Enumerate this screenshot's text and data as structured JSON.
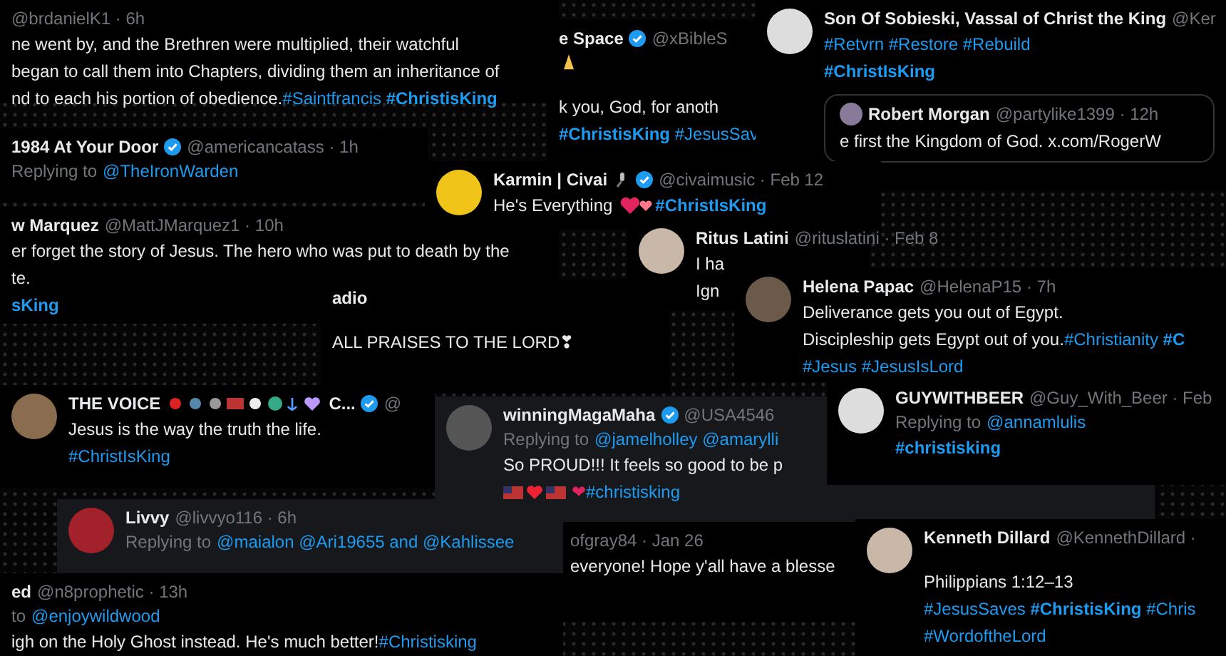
{
  "posts": [
    {
      "handle": "@brdanielK1 · 6h",
      "lines": [
        [
          {
            "t": "ne went by, and the Brethren were multiplied, their watchful",
            "link": false
          }
        ],
        [
          {
            "t": "began to call them into Chapters, dividing them an inheritance of",
            "link": false
          }
        ],
        [
          {
            "t": "nd to each his portion of obedience.",
            "link": false
          },
          {
            "t": "#Saintfrancis **#ChristisKing**",
            "link": true
          }
        ]
      ]
    },
    {
      "name": "e Space",
      "handle": "@xBibleS",
      "verified": true,
      "lines": [
        [
          {
            "t": "k you, God, for anoth",
            "link": false
          }
        ],
        [
          {
            "t": "**#ChristisKing** #JesusSav",
            "link": true
          }
        ]
      ]
    },
    {
      "name": "Son Of Sobieski, Vassal of Christ the King",
      "handle": "@Ker",
      "avatar": true,
      "lines": [
        [
          {
            "t": "#Retvrn #Restore #Rebuild",
            "link": true
          }
        ],
        [
          {
            "t": "**#ChristIsKing**",
            "link": true
          }
        ]
      ],
      "quote": {
        "name": "Robert Morgan",
        "handle": "@partylike1399 · 12h",
        "text": "e first the Kingdom of God. x.com/RogerW"
      }
    },
    {
      "name": "1984 At Your Door",
      "handle": "@americancatass · 1h",
      "verified": true,
      "reply": {
        "label": "Replying to",
        "to": "@TheIronWarden"
      }
    },
    {
      "name": "w Marquez",
      "handle": "@MattJMarquez1 · 10h",
      "lines": [
        [
          {
            "t": "er forget the story of Jesus. The hero who was put to death by the",
            "link": false
          }
        ],
        [
          {
            "t": "te.",
            "link": false
          }
        ],
        [
          {
            "t": "**sKing**",
            "link": true
          }
        ]
      ]
    },
    {
      "name": "Karmin | Civai",
      "handle": "@civaimusic · Feb 12",
      "verified": true,
      "avatar": true,
      "lines": [
        [
          {
            "t": "He's Everything",
            "link": false
          },
          {
            "t": "**#ChristIsKing**",
            "link": true
          }
        ]
      ]
    },
    {
      "name": "Ritus Latini",
      "handle": "@rituslatini · Feb 8",
      "avatar": true,
      "lines": [
        [
          {
            "t": "I ha",
            "link": false
          }
        ],
        [
          {
            "t": "Ign",
            "link": false
          }
        ]
      ]
    },
    {
      "name": "adio",
      "lines": [
        [
          {
            "t": "ALL PRAISES TO THE LORD❣",
            "link": false
          }
        ]
      ]
    },
    {
      "name": "Helena Papac",
      "handle": "@HelenaP15 · 7h",
      "avatar": true,
      "lines": [
        [
          {
            "t": "Deliverance gets you out of Egypt.",
            "link": false
          }
        ],
        [
          {
            "t": "Discipleship gets Egypt out of you.",
            "link": false
          },
          {
            "t": "#Christianity **#C**",
            "link": true
          }
        ],
        [
          {
            "t": "#Jesus #JesusIsLord",
            "link": true
          }
        ]
      ]
    },
    {
      "name": "THE VOICE",
      "name_tail": "C...",
      "handle": "@",
      "verified": true,
      "avatar": true,
      "lines": [
        [
          {
            "t": "Jesus is the way the truth the life.",
            "link": false
          }
        ],
        [
          {
            "t": "#ChristIsKing",
            "link": true
          }
        ]
      ]
    },
    {
      "name": "winningMagaMaha",
      "handle": "@USA4546",
      "verified": true,
      "avatar": true,
      "reply": {
        "label": "Replying to",
        "to": "@jamelholley @amarylli"
      },
      "lines": [
        [
          {
            "t": "So PROUD!!! It feels so good to be p",
            "link": false
          }
        ],
        [
          {
            "t": "❤",
            "link": false
          },
          {
            "t": "#christisking",
            "link": true
          }
        ]
      ]
    },
    {
      "name": "GUYWITHBEER",
      "handle": "@Guy_With_Beer · Feb",
      "avatar": true,
      "reply": {
        "label": "Replying to",
        "to": "@annamlulis"
      },
      "lines": [
        [
          {
            "t": "**#christisking**",
            "link": true
          }
        ]
      ]
    },
    {
      "name": "Livvy",
      "handle": "@livvyo116 · 6h",
      "avatar": true,
      "reply": {
        "label": "Replying to",
        "to": "@maialon @Ari19655 and @Kahlissee"
      }
    },
    {
      "name": "ed",
      "handle": "@n8prophetic · 13h",
      "reply": {
        "label": "to",
        "to": "@enjoywildwood"
      },
      "lines": [
        [
          {
            "t": "igh on the Holy Ghost instead. He's much better!",
            "link": false
          },
          {
            "t": "#Christisking",
            "link": true
          }
        ]
      ]
    },
    {
      "handle": "ofgray84 · Jan 26",
      "lines": [
        [
          {
            "t": "everyone! Hope y'all have a blesse",
            "link": false
          }
        ]
      ]
    },
    {
      "name": "Kenneth Dillard",
      "handle": "@KennethDillard ·",
      "avatar": true,
      "lines": [
        [
          {
            "t": "Philippians 1:12–13",
            "link": false
          }
        ],
        [
          {
            "t": "#JesusSaves **#ChristisKing** #Chris",
            "link": true
          }
        ],
        [
          {
            "t": "#WordoftheLord",
            "link": true
          }
        ]
      ]
    }
  ]
}
